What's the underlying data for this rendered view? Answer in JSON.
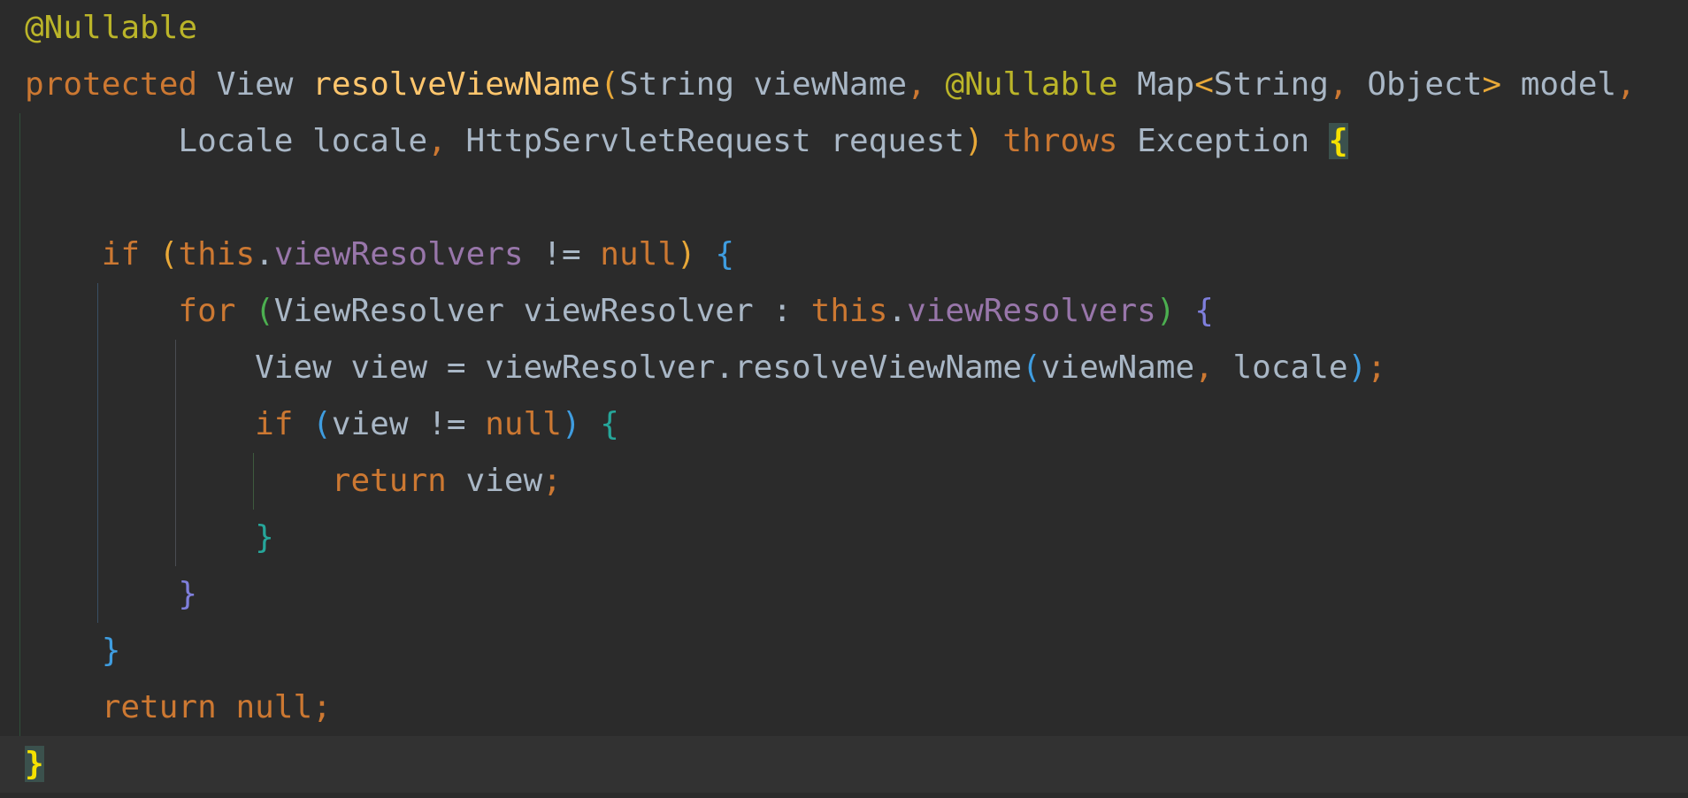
{
  "colors": {
    "background": "#2b2b2b",
    "current_line": "#323232",
    "annotation": "#bbb529",
    "keyword": "#cc7832",
    "method": "#ffc66d",
    "identifier": "#a9b7c6",
    "field": "#9876aa",
    "bracket_highlight": "#3b514d"
  },
  "code_lines": [
    [
      {
        "t": "@Nullable",
        "c": "ann"
      }
    ],
    [
      {
        "t": "protected",
        "c": "kw"
      },
      {
        "t": " ",
        "c": "id"
      },
      {
        "t": "View",
        "c": "ty"
      },
      {
        "t": " ",
        "c": "id"
      },
      {
        "t": "resolveViewName",
        "c": "fn"
      },
      {
        "t": "(",
        "c": "p-orange"
      },
      {
        "t": "String",
        "c": "ty"
      },
      {
        "t": " viewName",
        "c": "id"
      },
      {
        "t": ",",
        "c": "comma"
      },
      {
        "t": " ",
        "c": "id"
      },
      {
        "t": "@Nullable",
        "c": "ann"
      },
      {
        "t": " Map",
        "c": "ty"
      },
      {
        "t": "<",
        "c": "p-orange"
      },
      {
        "t": "String",
        "c": "ty"
      },
      {
        "t": ",",
        "c": "comma"
      },
      {
        "t": " Object",
        "c": "ty"
      },
      {
        "t": ">",
        "c": "p-orange"
      },
      {
        "t": " model",
        "c": "id"
      },
      {
        "t": ",",
        "c": "comma"
      }
    ],
    [
      {
        "t": "        ",
        "c": "id"
      },
      {
        "t": "Locale",
        "c": "ty"
      },
      {
        "t": " locale",
        "c": "id"
      },
      {
        "t": ",",
        "c": "comma"
      },
      {
        "t": " HttpServletRequest",
        "c": "ty"
      },
      {
        "t": " request",
        "c": "id"
      },
      {
        "t": ")",
        "c": "p-orange"
      },
      {
        "t": " ",
        "c": "id"
      },
      {
        "t": "throws",
        "c": "kw"
      },
      {
        "t": " Exception",
        "c": "ty"
      },
      {
        "t": " ",
        "c": "id"
      },
      {
        "t": "{",
        "c": "p-yellow hl"
      }
    ],
    [],
    [
      {
        "t": "    ",
        "c": "id"
      },
      {
        "t": "if",
        "c": "kw"
      },
      {
        "t": " ",
        "c": "id"
      },
      {
        "t": "(",
        "c": "p-orange"
      },
      {
        "t": "this",
        "c": "kw"
      },
      {
        "t": ".",
        "c": "pun"
      },
      {
        "t": "viewResolvers",
        "c": "field"
      },
      {
        "t": " != ",
        "c": "id"
      },
      {
        "t": "null",
        "c": "kw"
      },
      {
        "t": ")",
        "c": "p-orange"
      },
      {
        "t": " ",
        "c": "id"
      },
      {
        "t": "{",
        "c": "p-blue"
      }
    ],
    [
      {
        "t": "        ",
        "c": "id"
      },
      {
        "t": "for",
        "c": "kw"
      },
      {
        "t": " ",
        "c": "id"
      },
      {
        "t": "(",
        "c": "p-green"
      },
      {
        "t": "ViewResolver",
        "c": "ty"
      },
      {
        "t": " viewResolver : ",
        "c": "id"
      },
      {
        "t": "this",
        "c": "kw"
      },
      {
        "t": ".",
        "c": "pun"
      },
      {
        "t": "viewResolvers",
        "c": "field"
      },
      {
        "t": ")",
        "c": "p-green"
      },
      {
        "t": " ",
        "c": "id"
      },
      {
        "t": "{",
        "c": "p-purple"
      }
    ],
    [
      {
        "t": "            ",
        "c": "id"
      },
      {
        "t": "View",
        "c": "ty"
      },
      {
        "t": " view = viewResolver.resolveViewName",
        "c": "id"
      },
      {
        "t": "(",
        "c": "p-blue"
      },
      {
        "t": "viewName",
        "c": "id"
      },
      {
        "t": ",",
        "c": "comma"
      },
      {
        "t": " locale",
        "c": "id"
      },
      {
        "t": ")",
        "c": "p-blue"
      },
      {
        "t": ";",
        "c": "comma"
      }
    ],
    [
      {
        "t": "            ",
        "c": "id"
      },
      {
        "t": "if",
        "c": "kw"
      },
      {
        "t": " ",
        "c": "id"
      },
      {
        "t": "(",
        "c": "p-blue"
      },
      {
        "t": "view != ",
        "c": "id"
      },
      {
        "t": "null",
        "c": "kw"
      },
      {
        "t": ")",
        "c": "p-blue"
      },
      {
        "t": " ",
        "c": "id"
      },
      {
        "t": "{",
        "c": "p-teal"
      }
    ],
    [
      {
        "t": "                ",
        "c": "id"
      },
      {
        "t": "return",
        "c": "kw"
      },
      {
        "t": " view",
        "c": "id"
      },
      {
        "t": ";",
        "c": "comma"
      }
    ],
    [
      {
        "t": "            ",
        "c": "id"
      },
      {
        "t": "}",
        "c": "p-teal"
      }
    ],
    [
      {
        "t": "        ",
        "c": "id"
      },
      {
        "t": "}",
        "c": "p-purple"
      }
    ],
    [
      {
        "t": "    ",
        "c": "id"
      },
      {
        "t": "}",
        "c": "p-blue"
      }
    ],
    [
      {
        "t": "    ",
        "c": "id"
      },
      {
        "t": "return",
        "c": "kw"
      },
      {
        "t": " ",
        "c": "id"
      },
      {
        "t": "null",
        "c": "kw"
      },
      {
        "t": ";",
        "c": "comma"
      }
    ],
    [
      {
        "t": "}",
        "c": "p-yellow hl"
      }
    ]
  ]
}
